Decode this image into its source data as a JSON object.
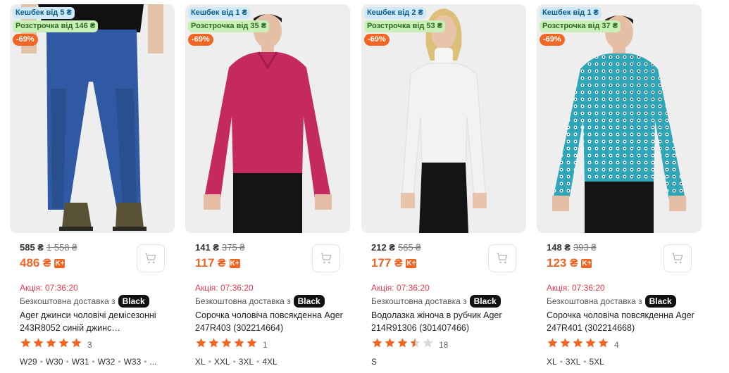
{
  "labels": {
    "delivery": "Безкоштовна доставка з",
    "black": "Black",
    "kplus": "K+"
  },
  "products": [
    {
      "cashback": "Кешбек від 5 ₴",
      "installment": "Розстрочка від 146 ₴",
      "discount": "-69%",
      "price_old_member": "585 ₴",
      "price_strike": "1 558 ₴",
      "price_new": "486 ₴",
      "timer": "Акція: 07:36:20",
      "title": "Ager джинси чоловічі демісезонні 243R8052 синій джинс…",
      "rating": 5,
      "reviews": "3",
      "sizes": [
        "W29",
        "W30",
        "W31",
        "W32",
        "W33",
        "..."
      ],
      "image_colors": {
        "top": "#111111",
        "bottom": "#2f5aa3",
        "accent": "#5a5236",
        "background": "#eeeeee"
      }
    },
    {
      "cashback": "Кешбек від 1 ₴",
      "installment": "Розстрочка від 35 ₴",
      "discount": "-69%",
      "price_old_member": "141 ₴",
      "price_strike": "375 ₴",
      "price_new": "117 ₴",
      "timer": "Акція: 07:36:20",
      "title": "Сорочка чоловіча повсякденна Ager 247R403 (302214664)",
      "rating": 5,
      "reviews": "1",
      "sizes": [
        "XL",
        "XXL",
        "3XL",
        "4XL"
      ],
      "image_colors": {
        "top": "#c42a5f",
        "bottom": "#141414",
        "accent": "#e4bfa5",
        "background": "#eeeeee"
      }
    },
    {
      "cashback": "Кешбек від 2 ₴",
      "installment": "Розстрочка від 53 ₴",
      "discount": "-69%",
      "price_old_member": "212 ₴",
      "price_strike": "565 ₴",
      "price_new": "177 ₴",
      "timer": "Акція: 07:36:20",
      "title": "Водолазка жіноча в рубчик Ager 214R91306 (301407466)",
      "rating": 3.5,
      "reviews": "18",
      "sizes": [
        "S"
      ],
      "image_colors": {
        "top": "#f2f2f2",
        "bottom": "#141414",
        "accent": "#e8c4ab",
        "background": "#eeeeee"
      }
    },
    {
      "cashback": "Кешбек від 1 ₴",
      "installment": "Розстрочка від 37 ₴",
      "discount": "-69%",
      "price_old_member": "148 ₴",
      "price_strike": "393 ₴",
      "price_new": "123 ₴",
      "timer": "Акція: 07:36:20",
      "title": "Сорочка чоловіча повсякденна Ager 247R401 (302214668)",
      "rating": 5,
      "reviews": "4",
      "sizes": [
        "XL",
        "3XL",
        "5XL"
      ],
      "image_colors": {
        "top": "#2fa7b8",
        "bottom": "#141414",
        "accent": "#e4bfa5",
        "background": "#eeeeee"
      }
    }
  ]
}
